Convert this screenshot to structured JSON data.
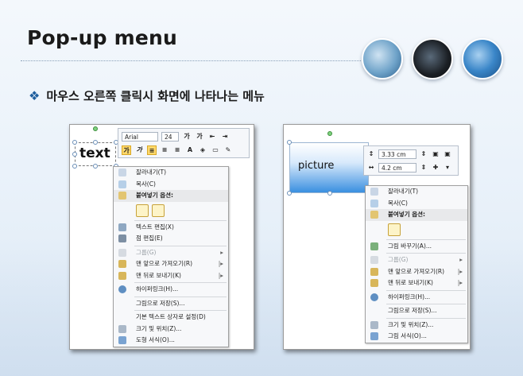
{
  "slide": {
    "title": "Pop-up menu",
    "subheading": "마우스 오른쪽 클릭시 화면에 나타나는 메뉴",
    "bullet": "❖"
  },
  "left_panel": {
    "textbox_text": "text",
    "toolbar": {
      "font": "Arial",
      "size": "24",
      "row1_buttons": [
        "가",
        "가"
      ],
      "row2_buttons": [
        "가",
        "가"
      ]
    },
    "menu": {
      "items": [
        {
          "label": "잘라내기(T)",
          "icon": "scissors-icon",
          "disabled": false
        },
        {
          "label": "복사(C)",
          "icon": "copy-icon",
          "disabled": false
        },
        {
          "label": "붙여넣기 옵션:",
          "icon": "clipboard-icon",
          "header": true
        },
        {
          "label": "텍스트 편집(X)",
          "icon": "edit-text-icon",
          "disabled": false
        },
        {
          "label": "점 편집(E)",
          "icon": "edit-points-icon",
          "disabled": false
        },
        {
          "label": "그룹(G)",
          "icon": "group-icon",
          "disabled": true,
          "submenu": true
        },
        {
          "label": "맨 앞으로 가져오기(R)",
          "icon": "bring-front-icon",
          "disabled": false,
          "submenu": true
        },
        {
          "label": "맨 뒤로 보내기(K)",
          "icon": "send-back-icon",
          "disabled": false,
          "submenu": true
        },
        {
          "label": "하이퍼링크(H)...",
          "icon": "hyperlink-icon",
          "disabled": false
        },
        {
          "label": "그림으로 저장(S)...",
          "icon": "",
          "disabled": false
        },
        {
          "label": "기본 텍스트 상자로 설정(D)",
          "icon": "",
          "disabled": false
        },
        {
          "label": "크기 및 위치(Z)...",
          "icon": "size-position-icon",
          "disabled": false
        },
        {
          "label": "도형 서식(O)...",
          "icon": "format-shape-icon",
          "disabled": false
        }
      ]
    }
  },
  "right_panel": {
    "picture_text": "picture",
    "toolbar": {
      "height": "3.33 cm",
      "width": "4.2 cm"
    },
    "menu": {
      "items": [
        {
          "label": "잘라내기(T)",
          "icon": "scissors-icon",
          "disabled": false
        },
        {
          "label": "복사(C)",
          "icon": "copy-icon",
          "disabled": false
        },
        {
          "label": "붙여넣기 옵션:",
          "icon": "clipboard-icon",
          "header": true
        },
        {
          "label": "그림 바꾸기(A)...",
          "icon": "change-picture-icon",
          "disabled": false
        },
        {
          "label": "그룹(G)",
          "icon": "group-icon",
          "disabled": true,
          "submenu": true
        },
        {
          "label": "맨 앞으로 가져오기(R)",
          "icon": "bring-front-icon",
          "disabled": false,
          "submenu": true
        },
        {
          "label": "맨 뒤로 보내기(K)",
          "icon": "send-back-icon",
          "disabled": false,
          "submenu": true
        },
        {
          "label": "하이퍼링크(H)...",
          "icon": "hyperlink-icon",
          "disabled": false
        },
        {
          "label": "그림으로 저장(S)...",
          "icon": "",
          "disabled": false
        },
        {
          "label": "크기 및 위치(Z)...",
          "icon": "size-position-icon",
          "disabled": false
        },
        {
          "label": "그림 서식(O)...",
          "icon": "format-picture-icon",
          "disabled": false
        }
      ]
    }
  },
  "colors": {
    "accent": "#1f5f9e",
    "menu_bg": "#f7f8fa",
    "highlight": "#ffd86b"
  }
}
